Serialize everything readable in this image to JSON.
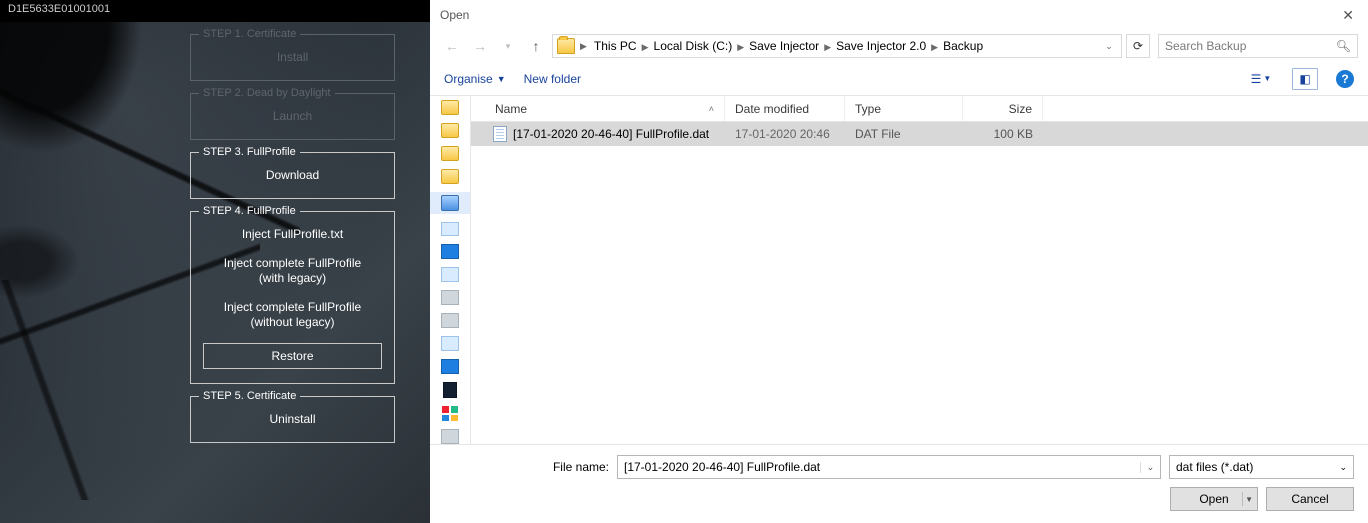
{
  "left_app": {
    "title": "D1E5633E01001001",
    "steps": [
      {
        "legend": "STEP 1. Certificate",
        "dim": true,
        "buttons": [
          {
            "label": "Install",
            "bordered": false
          }
        ]
      },
      {
        "legend": "STEP 2. Dead by Daylight",
        "dim": true,
        "buttons": [
          {
            "label": "Launch",
            "bordered": false
          }
        ]
      },
      {
        "legend": "STEP 3. FullProfile",
        "dim": false,
        "buttons": [
          {
            "label": "Download",
            "bordered": false
          }
        ]
      },
      {
        "legend": "STEP 4. FullProfile",
        "dim": false,
        "buttons": [
          {
            "label": "Inject FullProfile.txt",
            "bordered": false
          },
          {
            "label": "Inject complete FullProfile\n(with legacy)",
            "tall": true,
            "bordered": false
          },
          {
            "label": "Inject complete FullProfile\n(without legacy)",
            "tall": true,
            "bordered": false
          },
          {
            "label": "Restore",
            "bordered": true
          }
        ]
      },
      {
        "legend": "STEP 5. Certificate",
        "dim": false,
        "buttons": [
          {
            "label": "Uninstall",
            "bordered": false
          }
        ]
      }
    ]
  },
  "dialog": {
    "title": "Open",
    "breadcrumbs": [
      "This PC",
      "Local Disk (C:)",
      "Save Injector",
      "Save Injector 2.0",
      "Backup"
    ],
    "search_placeholder": "Search Backup",
    "toolbar": {
      "organise": "Organise",
      "new_folder": "New folder"
    },
    "columns": {
      "name": "Name",
      "date": "Date modified",
      "type": "Type",
      "size": "Size"
    },
    "rows": [
      {
        "name": "[17-01-2020 20-46-40] FullProfile.dat",
        "date": "17-01-2020 20:46",
        "type": "DAT File",
        "size": "100 KB",
        "selected": true
      }
    ],
    "file_name_label": "File name:",
    "file_name_value": "[17-01-2020 20-46-40] FullProfile.dat",
    "filter": "dat files (*.dat)",
    "open_btn": "Open",
    "cancel_btn": "Cancel"
  }
}
